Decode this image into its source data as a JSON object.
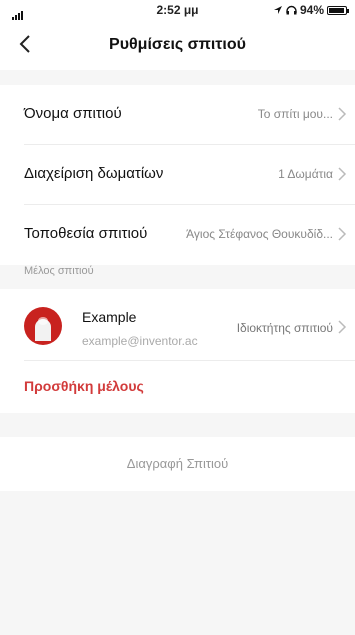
{
  "status_bar": {
    "time": "2:52 μμ",
    "battery": "94%",
    "battery_level": 0.94,
    "icons": [
      "signal-icon",
      "location-arrow-icon",
      "headphones-icon",
      "battery-icon"
    ]
  },
  "header": {
    "title": "Ρυθμίσεις σπιτιού",
    "back_icon": "chevron-left-icon"
  },
  "settings": {
    "rows": [
      {
        "label": "Όνομα σπιτιού",
        "value": "Το σπίτι μου..."
      },
      {
        "label": "Διαχείριση δωματίων",
        "value": "1 Δωμάτια"
      },
      {
        "label": "Τοποθεσία σπιτιού",
        "value": "Άγιος Στέφανος Θουκυδίδ..."
      }
    ]
  },
  "members": {
    "section_label": "Μέλος σπιτιού",
    "list": [
      {
        "name": "Example",
        "email": "example@inventor.ac",
        "role": "Ιδιοκτήτης σπιτιού"
      }
    ],
    "add_label": "Προσθήκη μέλους"
  },
  "delete_home_label": "Διαγραφή Σπιτιού",
  "colors": {
    "accent_red": "#d23b3b",
    "background": "#f6f6f6",
    "card": "#ffffff"
  }
}
